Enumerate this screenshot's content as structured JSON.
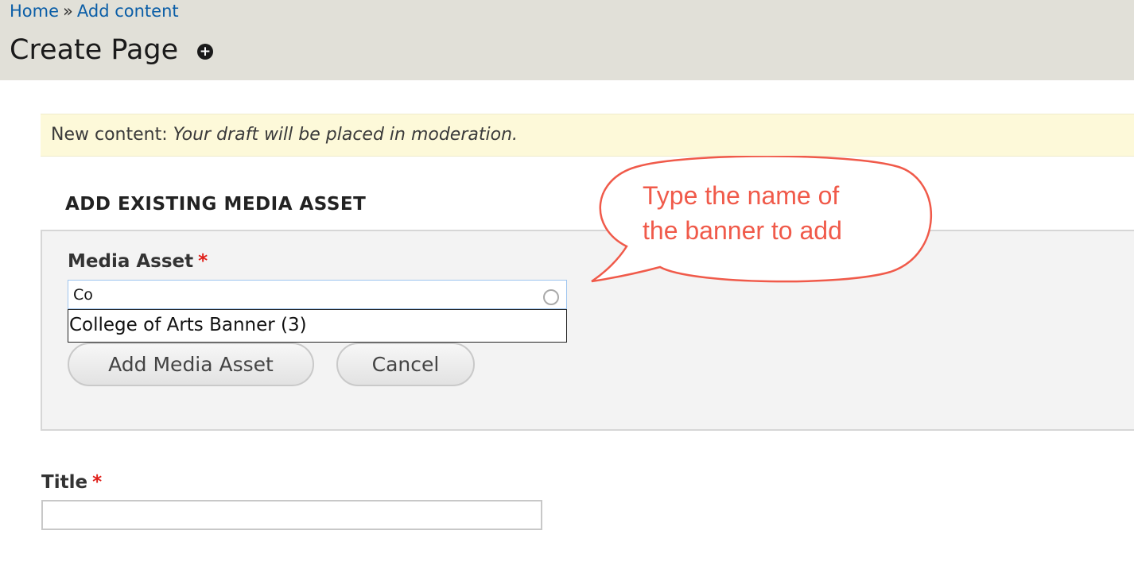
{
  "breadcrumb": {
    "home": "Home",
    "separator": "»",
    "add_content": "Add content"
  },
  "page": {
    "title": "Create Page",
    "shortcut_icon": "+"
  },
  "message": {
    "prefix": "New content:",
    "text": "Your draft will be placed in moderation."
  },
  "media_section": {
    "legend": "ADD EXISTING MEDIA ASSET",
    "field_label": "Media Asset",
    "required_marker": "*",
    "input_value": "Co",
    "autocomplete_suggestions": [
      "College of Arts Banner (3)"
    ],
    "add_button": "Add Media Asset",
    "cancel_button": "Cancel"
  },
  "title_field": {
    "label": "Title",
    "required_marker": "*",
    "value": ""
  },
  "annotation": {
    "line1": "Type the name of",
    "line2": "the banner to add"
  },
  "colors": {
    "header_bg": "#e1e0d8",
    "link": "#0b5ea7",
    "message_bg": "#fdf9d9",
    "required": "#e0211b",
    "annotation": "#f05a4a"
  }
}
